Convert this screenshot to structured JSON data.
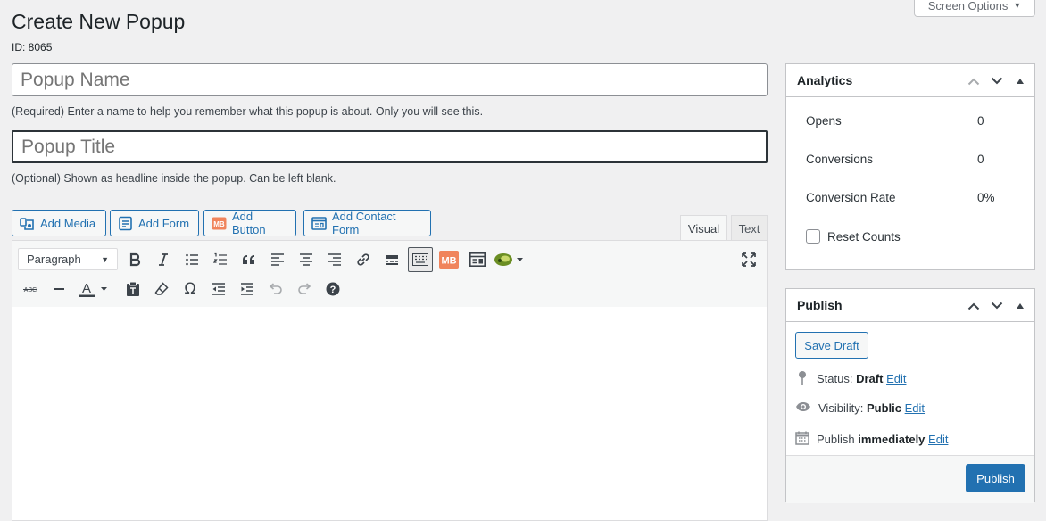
{
  "page": {
    "title": "Create New Popup",
    "id_text": "ID: 8065"
  },
  "screen_options": {
    "label": "Screen Options"
  },
  "popup_name": {
    "placeholder": "Popup Name",
    "hint": "(Required) Enter a name to help you remember what this popup is about. Only you will see this."
  },
  "popup_title": {
    "placeholder": "Popup Title",
    "hint": "(Optional) Shown as headline inside the popup. Can be left blank."
  },
  "media_buttons": {
    "add_media": "Add Media",
    "add_form": "Add Form",
    "add_button": "Add Button",
    "add_contact_form": "Add Contact Form",
    "mb_icon_text": "MB"
  },
  "editor": {
    "tabs": {
      "visual": "Visual",
      "text": "Text"
    },
    "format_select": "Paragraph",
    "toolbar_icons": [
      "bold-icon",
      "italic-icon",
      "bulleted-list-icon",
      "numbered-list-icon",
      "blockquote-icon",
      "align-left-icon",
      "align-center-icon",
      "align-right-icon",
      "link-icon",
      "read-more-icon",
      "toolbar-toggle-icon",
      "mb-icon",
      "form-icon",
      "plugin-icon",
      "fullscreen-icon",
      "strikethrough-icon",
      "horizontal-line-icon",
      "text-color-icon",
      "paste-text-icon",
      "clear-formatting-icon",
      "special-character-icon",
      "outdent-icon",
      "indent-icon",
      "undo-icon",
      "redo-icon",
      "help-icon"
    ],
    "toolbar_text": {
      "mb": "MB",
      "omega": "Ω",
      "abc": "ABC",
      "a_letter": "A",
      "help": "?"
    }
  },
  "analytics": {
    "title": "Analytics",
    "rows": [
      {
        "label": "Opens",
        "value": "0"
      },
      {
        "label": "Conversions",
        "value": "0"
      },
      {
        "label": "Conversion Rate",
        "value": "0%"
      }
    ],
    "reset_label": "Reset Counts"
  },
  "publish": {
    "title": "Publish",
    "save_draft": "Save Draft",
    "status_label": "Status:",
    "status_value": "Draft",
    "visibility_label": "Visibility:",
    "visibility_value": "Public",
    "schedule_label": "Publish",
    "schedule_value": "immediately",
    "edit": "Edit",
    "publish_button": "Publish"
  },
  "colors": {
    "primary": "#2271b1",
    "mb_orange": "#f0845c",
    "plugin_green": "#6b8e23"
  }
}
